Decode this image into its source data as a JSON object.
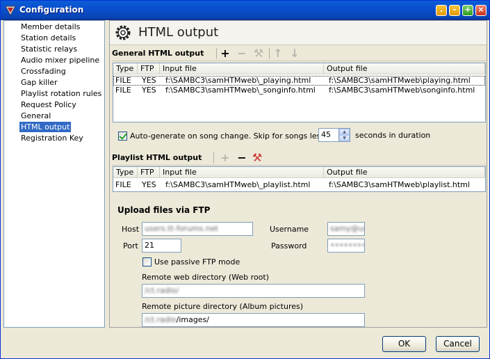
{
  "window": {
    "title": "Configuration"
  },
  "nav": {
    "items": [
      "Member details",
      "Station details",
      "Statistic relays",
      "Audio mixer pipeline",
      "Crossfading",
      "Gap killer",
      "Playlist rotation rules",
      "Request Policy",
      "General",
      "HTML output",
      "Registration Key"
    ],
    "selected": "HTML output"
  },
  "page": {
    "title": "HTML output"
  },
  "general_output": {
    "title": "General HTML output",
    "columns": [
      "Type",
      "FTP",
      "Input file",
      "Output file"
    ],
    "rows": [
      {
        "type": "FILE",
        "ftp": "YES",
        "input": "f:\\SAMBC3\\samHTMweb\\_playing.html",
        "output": "f:\\SAMBC3\\samHTMweb\\playing.html"
      },
      {
        "type": "FILE",
        "ftp": "YES",
        "input": "f:\\SAMBC3\\samHTMweb\\_songinfo.html",
        "output": "f:\\SAMBC3\\samHTMweb\\songinfo.html"
      }
    ]
  },
  "auto_generate": {
    "checked": true,
    "label": "Auto-generate on song change. Skip for songs less than",
    "value": "45",
    "suffix": "seconds in duration"
  },
  "playlist_output": {
    "title": "Playlist HTML output",
    "columns": [
      "Type",
      "FTP",
      "Input file",
      "Output file"
    ],
    "rows": [
      {
        "type": "FILE",
        "ftp": "YES",
        "input": "f:\\SAMBC3\\samHTMweb\\_playlist.html",
        "output": "f:\\SAMBC3\\samHTMweb\\playlist.html"
      }
    ]
  },
  "ftp": {
    "title": "Upload files via FTP",
    "host_label": "Host",
    "host_value": "users.tt-forums.net",
    "username_label": "Username",
    "username_value": "samy@users2.tt",
    "port_label": "Port",
    "port_value": "21",
    "password_label": "Password",
    "password_value": "••••••••",
    "passive_label": "Use passive FTP mode",
    "passive_checked": false,
    "web_dir_label": "Remote web directory (Web root)",
    "web_dir_value": "/ct.radio/",
    "pic_dir_label": "Remote picture directory (Album pictures)",
    "pic_dir_value_blur": "/ct.radio",
    "pic_dir_value_clear": "/images/"
  },
  "buttons": {
    "ok": "OK",
    "cancel": "Cancel"
  }
}
